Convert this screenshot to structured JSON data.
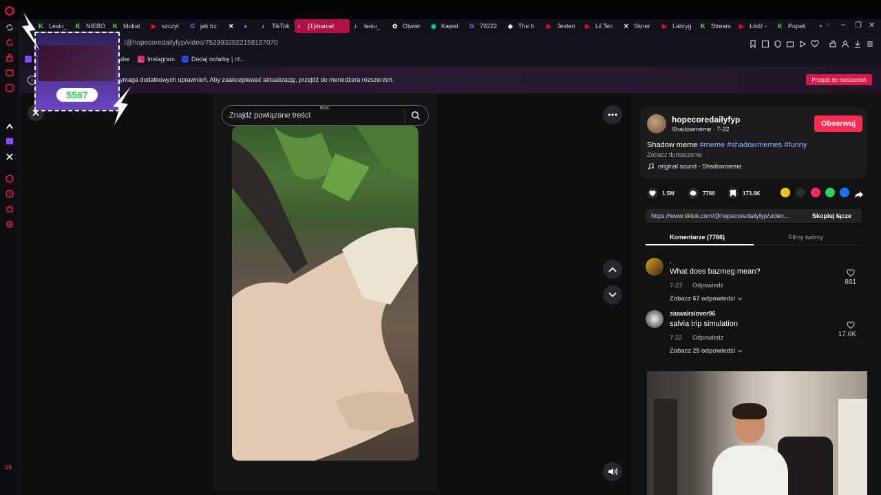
{
  "browser": {
    "tabs": [
      {
        "label": "Lesiu_",
        "icon": "kick-icon",
        "color": "#53fc18"
      },
      {
        "label": "NIEBO",
        "icon": "kick-icon",
        "color": "#53fc18"
      },
      {
        "label": "Mokat",
        "icon": "kick-icon",
        "color": "#53fc18"
      },
      {
        "label": "szczyl",
        "icon": "youtube-icon",
        "color": "#ff0033"
      },
      {
        "label": "jak trz",
        "icon": "google-icon",
        "color": "#4285f4"
      },
      {
        "label": "",
        "icon": "x-icon",
        "color": "#ffffff"
      },
      {
        "label": "",
        "icon": "globe-icon",
        "color": "#1d9bf0"
      },
      {
        "label": "TikTok",
        "icon": "tiktok-icon",
        "color": "#ffffff"
      },
      {
        "label": "(1)marcel",
        "icon": "tiktok-icon",
        "color": "#ffffff",
        "active": true
      },
      {
        "label": "lesiu_",
        "icon": "tiktok-icon",
        "color": "#ffffff"
      },
      {
        "label": "Otwier",
        "icon": "chatgpt-icon",
        "color": "#ffffff"
      },
      {
        "label": "Kawał",
        "icon": "kawal-icon",
        "color": "#00d4a0"
      },
      {
        "label": "79222",
        "icon": "google-icon",
        "color": "#4285f4"
      },
      {
        "label": "The b",
        "icon": "the-b-icon",
        "color": "#ffffff"
      },
      {
        "label": "Jesten",
        "icon": "youtube-icon",
        "color": "#ff0033"
      },
      {
        "label": "Lil Tec",
        "icon": "youtube-icon",
        "color": "#ff0033"
      },
      {
        "label": "Skner",
        "icon": "x-icon",
        "color": "#ffffff"
      },
      {
        "label": "Labryg",
        "icon": "youtube-icon",
        "color": "#ff0033"
      },
      {
        "label": "Stream",
        "icon": "kick-icon",
        "color": "#53fc18"
      },
      {
        "label": "Łódź -",
        "icon": "youtube-icon",
        "color": "#ff0033"
      },
      {
        "label": "Popek",
        "icon": "kick-icon",
        "color": "#53fc18"
      }
    ],
    "new_tab": "+",
    "address": "/@hopecoredailyfyp/video/7529932922158157070",
    "bookmarks": [
      {
        "label": "ube",
        "icon": "youtube-icon"
      },
      {
        "label": "Instagram",
        "icon": "instagram-icon"
      },
      {
        "label": "Dodaj notatkę | nt...",
        "icon": "notion-icon"
      }
    ]
  },
  "notification": {
    "text": "ymaga dodatkowych uprawnień. Aby zaakceptować aktualizację, przejdź do menedżera rozszerzeń.",
    "button": "Przejdź do rozszerzeń"
  },
  "player": {
    "search_placeholder": "Znajdź powiązane treści",
    "rgx_label": "RGX"
  },
  "post": {
    "username": "hopecoredailyfyp",
    "subline": "Shadowmeme · 7-22",
    "follow_label": "Obserwuj",
    "caption": "Shadow meme",
    "hashtags": [
      "#meme",
      "#shadowmemes",
      "#funny"
    ],
    "translate": "Zobacz tłumaczenie",
    "sound": "original sound - Shadowmeme",
    "likes": "1.5M",
    "comments": "7766",
    "saves": "173.6K",
    "link": "https://www.tiktok.com/@hopecoredailyfyp/video...",
    "copy_label": "Skopiuj łącze",
    "tab_comments": "Komentarze (7766)",
    "tab_videos": "Filmy twórcy"
  },
  "comments": [
    {
      "user": ".",
      "text": "What does bazmeg mean?",
      "date": "7-23",
      "reply": "Odpowiedz",
      "more": "Zobacz 67 odpowiedzi",
      "likes": "891"
    },
    {
      "user": "siuwakslover96",
      "text": "salvia trip simulation",
      "date": "7-22",
      "reply": "Odpowiedz",
      "more": "Zobacz 25 odpowiedzi",
      "likes": "17.6K"
    }
  ],
  "overlay": {
    "amount": "$567"
  },
  "sidebar_bottom": "GX",
  "colors": {
    "accent": "#fe2c55",
    "opera_red": "#ff1a4b",
    "hashtag": "#8fb0ff"
  }
}
